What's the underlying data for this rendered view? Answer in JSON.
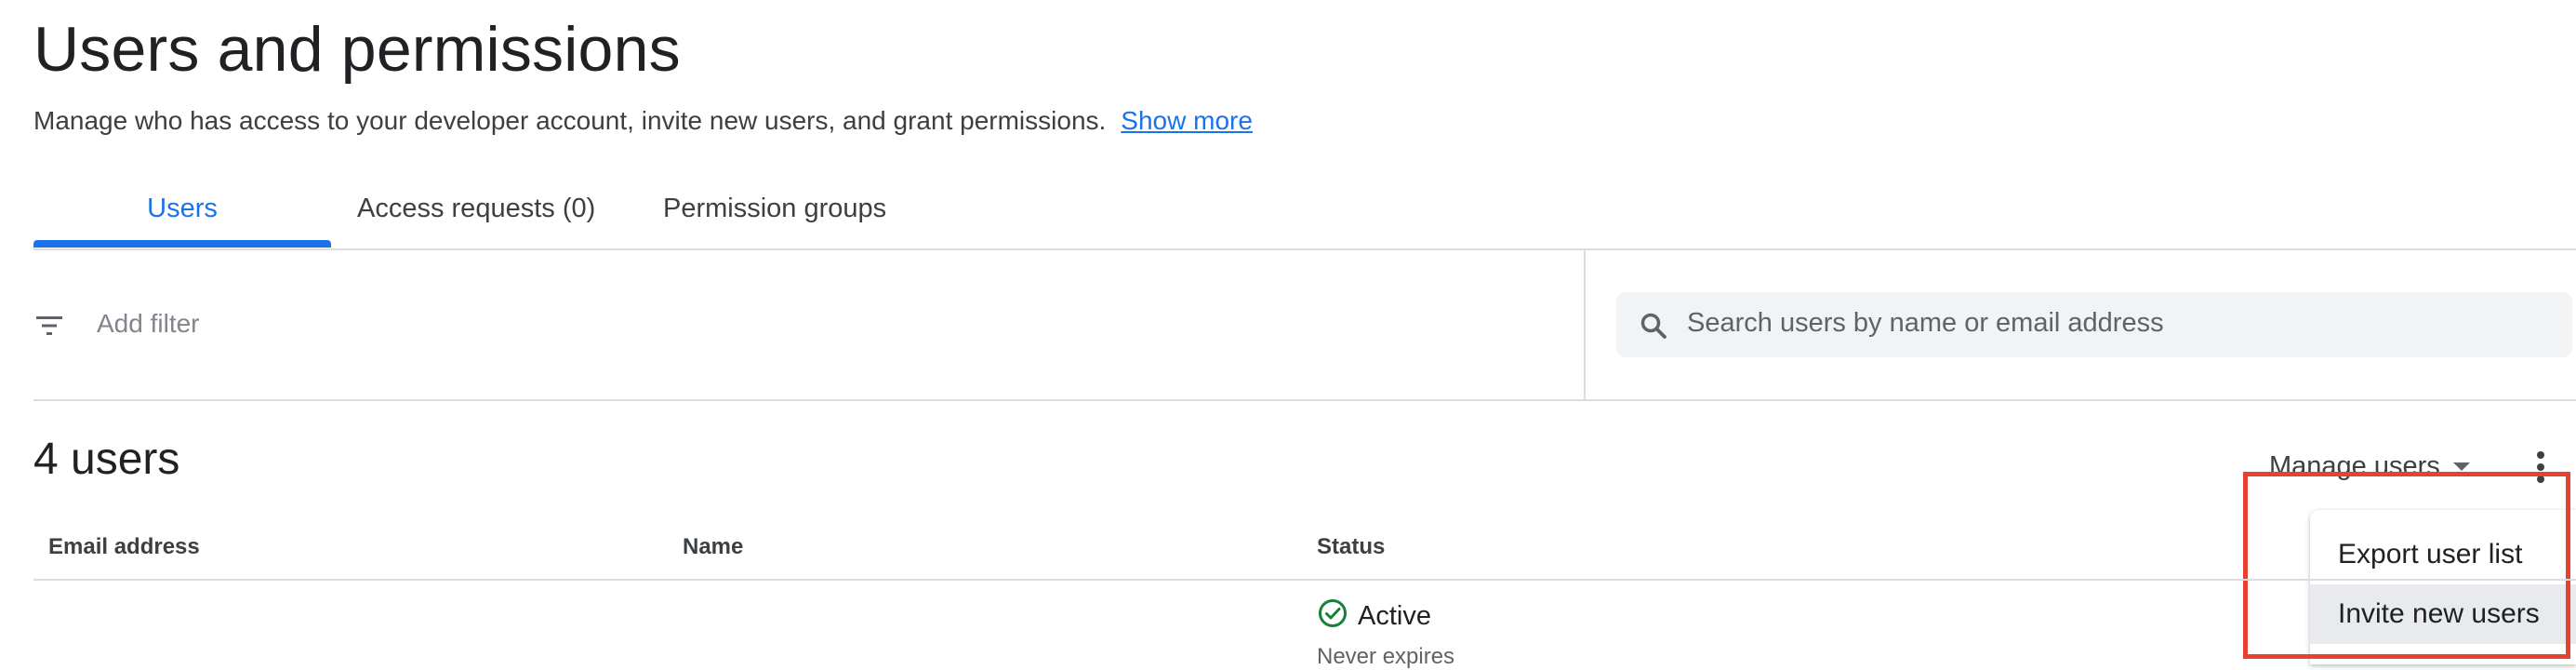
{
  "page": {
    "title": "Users and permissions",
    "description": "Manage who has access to your developer account, invite new users, and grant permissions.",
    "show_more": "Show more"
  },
  "tabs": [
    {
      "label": "Users",
      "active": true
    },
    {
      "label": "Access requests (0)",
      "active": false
    },
    {
      "label": "Permission groups",
      "active": false
    }
  ],
  "filter": {
    "label": "Add filter",
    "icon": "filter-list-icon"
  },
  "search": {
    "placeholder": "Search users by name or email address",
    "icon": "search-icon"
  },
  "users_section": {
    "count_label": "4 users",
    "manage_users_label": "Manage users",
    "more_icon": "more-vert-icon"
  },
  "menu": {
    "items": [
      {
        "label": "Export user list"
      },
      {
        "label": "Invite new users",
        "hovered": true
      }
    ]
  },
  "table": {
    "headers": [
      "Email address",
      "Name",
      "Status"
    ],
    "rows": [
      {
        "email": "",
        "name": "",
        "status": "Active",
        "status_sub": "Never expires",
        "status_icon": "check-circle-icon"
      }
    ]
  },
  "colors": {
    "accent": "#1a73e8",
    "highlight": "#e8412f",
    "status_ok": "#188038"
  }
}
